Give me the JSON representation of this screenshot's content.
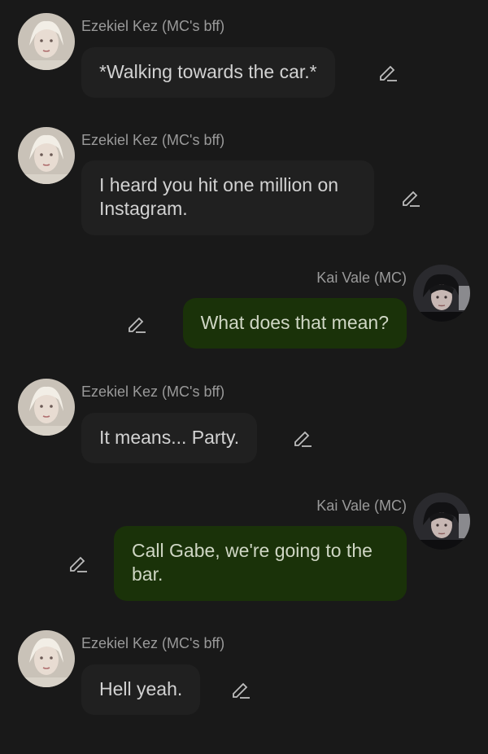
{
  "messages": [
    {
      "sender": "Ezekiel Kez (MC's bff)",
      "text": "*Walking towards the car.*",
      "side": "left"
    },
    {
      "sender": "Ezekiel Kez (MC's bff)",
      "text": "I heard you hit one million on Instagram.",
      "side": "left"
    },
    {
      "sender": "Kai Vale (MC)",
      "text": "What does that mean?",
      "side": "right"
    },
    {
      "sender": "Ezekiel Kez (MC's bff)",
      "text": "It means... Party.",
      "side": "left"
    },
    {
      "sender": "Kai Vale (MC)",
      "text": "Call Gabe, we're going to the bar.",
      "side": "right"
    },
    {
      "sender": "Ezekiel Kez (MC's bff)",
      "text": "Hell yeah.",
      "side": "left"
    }
  ],
  "icons": {
    "edit": "pencil-edit-icon",
    "avatar_left": "avatar-ezekiel",
    "avatar_right": "avatar-kai"
  },
  "colors": {
    "background": "#191919",
    "bubble_left": "#202020",
    "bubble_right": "#1a3209",
    "name": "#9a9a9a"
  }
}
